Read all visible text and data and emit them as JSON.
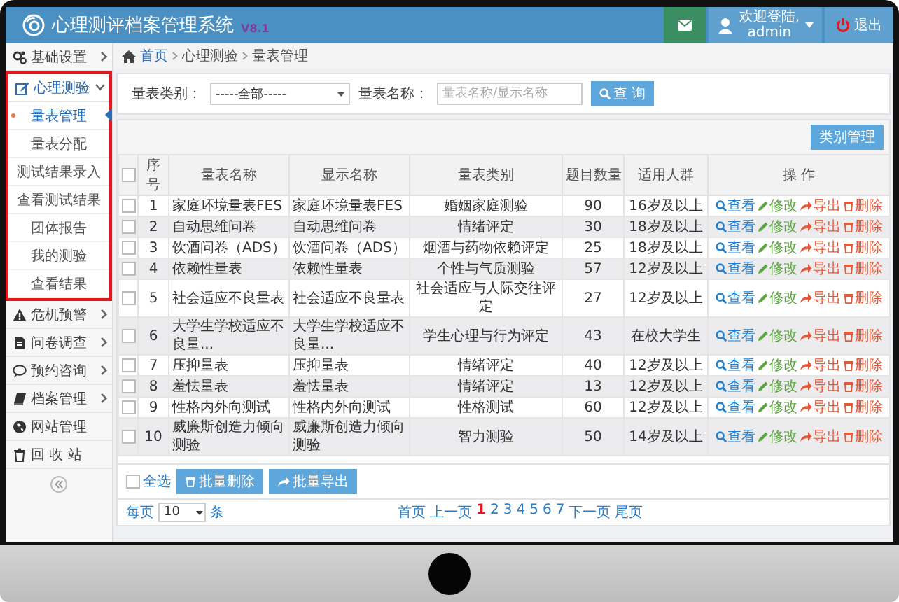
{
  "header": {
    "title": "心理测评档案管理系统",
    "version": "V8.1",
    "greeting": "欢迎登陆,",
    "user": "admin",
    "logout": "退出"
  },
  "sidebar": {
    "items": [
      {
        "kind": "group",
        "label": "基础设置",
        "expanded": false
      },
      {
        "kind": "group",
        "label": "心理测验",
        "expanded": true,
        "highlighted": true,
        "children": [
          {
            "label": "量表管理",
            "selected": true
          },
          {
            "label": "量表分配",
            "selected": false
          },
          {
            "label": "测试结果录入",
            "selected": false
          },
          {
            "label": "查看测试结果",
            "selected": false
          },
          {
            "label": "团体报告",
            "selected": false
          },
          {
            "label": "我的测验",
            "selected": false
          },
          {
            "label": "查看结果",
            "selected": false
          }
        ]
      },
      {
        "kind": "group",
        "label": "危机预警",
        "expanded": false
      },
      {
        "kind": "group",
        "label": "问卷调查",
        "expanded": false
      },
      {
        "kind": "group",
        "label": "预约咨询",
        "expanded": false
      },
      {
        "kind": "group",
        "label": "档案管理",
        "expanded": false
      },
      {
        "kind": "link",
        "label": "网站管理"
      },
      {
        "kind": "link",
        "label": "回 收 站"
      }
    ]
  },
  "breadcrumb": [
    "首页",
    "心理测验",
    "量表管理"
  ],
  "search": {
    "category_label": "量表类别：",
    "category_value": "-----全部-----",
    "name_label": "量表名称：",
    "name_placeholder": "量表名称/显示名称",
    "button": "查 询"
  },
  "toolbar": {
    "button": "类别管理"
  },
  "table": {
    "columns": [
      "序号",
      "量表名称",
      "显示名称",
      "量表类别",
      "题目数量",
      "适用人群",
      "操 作"
    ],
    "header_checked": false,
    "rows": [
      {
        "checked": false,
        "cells": [
          "1",
          "家庭环境量表FES",
          "家庭环境量表FES",
          "婚姻家庭测验",
          "90",
          "16岁及以上"
        ],
        "actions": [
          {
            "kind": "view",
            "label": "查看"
          },
          {
            "kind": "edit",
            "label": "修改"
          },
          {
            "kind": "export",
            "label": "导出"
          },
          {
            "kind": "delete",
            "label": "删除"
          }
        ]
      },
      {
        "checked": false,
        "cells": [
          "2",
          "自动思维问卷",
          "自动思维问卷",
          "情绪评定",
          "30",
          "18岁及以上"
        ],
        "actions": [
          {
            "kind": "view",
            "label": "查看"
          },
          {
            "kind": "edit",
            "label": "修改"
          },
          {
            "kind": "export",
            "label": "导出"
          },
          {
            "kind": "delete",
            "label": "删除"
          }
        ]
      },
      {
        "checked": false,
        "cells": [
          "3",
          "饮酒问卷（ADS）",
          "饮酒问卷（ADS）",
          "烟酒与药物依赖评定",
          "25",
          "18岁及以上"
        ],
        "actions": [
          {
            "kind": "view",
            "label": "查看"
          },
          {
            "kind": "edit",
            "label": "修改"
          },
          {
            "kind": "export",
            "label": "导出"
          },
          {
            "kind": "delete",
            "label": "删除"
          }
        ]
      },
      {
        "checked": false,
        "cells": [
          "4",
          "依赖性量表",
          "依赖性量表",
          "个性与气质测验",
          "57",
          "12岁及以上"
        ],
        "actions": [
          {
            "kind": "view",
            "label": "查看"
          },
          {
            "kind": "edit",
            "label": "修改"
          },
          {
            "kind": "export",
            "label": "导出"
          },
          {
            "kind": "delete",
            "label": "删除"
          }
        ]
      },
      {
        "checked": false,
        "cells": [
          "5",
          "社会适应不良量表",
          "社会适应不良量表",
          "社会适应与人际交往评定",
          "27",
          "12岁及以上"
        ],
        "actions": [
          {
            "kind": "view",
            "label": "查看"
          },
          {
            "kind": "edit",
            "label": "修改"
          },
          {
            "kind": "export",
            "label": "导出"
          },
          {
            "kind": "delete",
            "label": "删除"
          }
        ]
      },
      {
        "checked": false,
        "cells": [
          "6",
          "大学生学校适应不良量...",
          "大学生学校适应不良量...",
          "学生心理与行为评定",
          "43",
          "在校大学生"
        ],
        "actions": [
          {
            "kind": "view",
            "label": "查看"
          },
          {
            "kind": "edit",
            "label": "修改"
          },
          {
            "kind": "export",
            "label": "导出"
          },
          {
            "kind": "delete",
            "label": "删除"
          }
        ]
      },
      {
        "checked": false,
        "cells": [
          "7",
          "压抑量表",
          "压抑量表",
          "情绪评定",
          "40",
          "12岁及以上"
        ],
        "actions": [
          {
            "kind": "view",
            "label": "查看"
          },
          {
            "kind": "edit",
            "label": "修改"
          },
          {
            "kind": "export",
            "label": "导出"
          },
          {
            "kind": "delete",
            "label": "删除"
          }
        ]
      },
      {
        "checked": false,
        "cells": [
          "8",
          "羞怯量表",
          "羞怯量表",
          "情绪评定",
          "13",
          "12岁及以上"
        ],
        "actions": [
          {
            "kind": "view",
            "label": "查看"
          },
          {
            "kind": "edit",
            "label": "修改"
          },
          {
            "kind": "export",
            "label": "导出"
          },
          {
            "kind": "delete",
            "label": "删除"
          }
        ]
      },
      {
        "checked": false,
        "cells": [
          "9",
          "性格内外向测试",
          "性格内外向测试",
          "性格测试",
          "60",
          "12岁及以上"
        ],
        "actions": [
          {
            "kind": "view",
            "label": "查看"
          },
          {
            "kind": "edit",
            "label": "修改"
          },
          {
            "kind": "export",
            "label": "导出"
          },
          {
            "kind": "delete",
            "label": "删除"
          }
        ]
      },
      {
        "checked": false,
        "cells": [
          "10",
          "威廉斯创造力倾向测验",
          "威廉斯创造力倾向测验",
          "智力测验",
          "50",
          "14岁及以上"
        ],
        "actions": [
          {
            "kind": "view",
            "label": "查看"
          },
          {
            "kind": "edit",
            "label": "修改"
          },
          {
            "kind": "export",
            "label": "导出"
          },
          {
            "kind": "delete",
            "label": "删除"
          }
        ]
      }
    ]
  },
  "bulk": {
    "select_all": {
      "label": "全选",
      "checked": false
    },
    "buttons": [
      {
        "kind": "delete",
        "label": "批量删除"
      },
      {
        "kind": "export",
        "label": "批量导出"
      }
    ]
  },
  "pagination": {
    "per_page_label": "每页",
    "per_page_value": "10",
    "per_page_unit": "条",
    "links": [
      {
        "label": "首页",
        "selected": false
      },
      {
        "label": "上一页",
        "selected": false
      },
      {
        "label": "1",
        "selected": true
      },
      {
        "label": "2",
        "selected": false
      },
      {
        "label": "3",
        "selected": false
      },
      {
        "label": "4",
        "selected": false
      },
      {
        "label": "5",
        "selected": false
      },
      {
        "label": "6",
        "selected": false
      },
      {
        "label": "7",
        "selected": false
      },
      {
        "label": "下一页",
        "selected": false
      },
      {
        "label": "尾页",
        "selected": false
      }
    ]
  }
}
